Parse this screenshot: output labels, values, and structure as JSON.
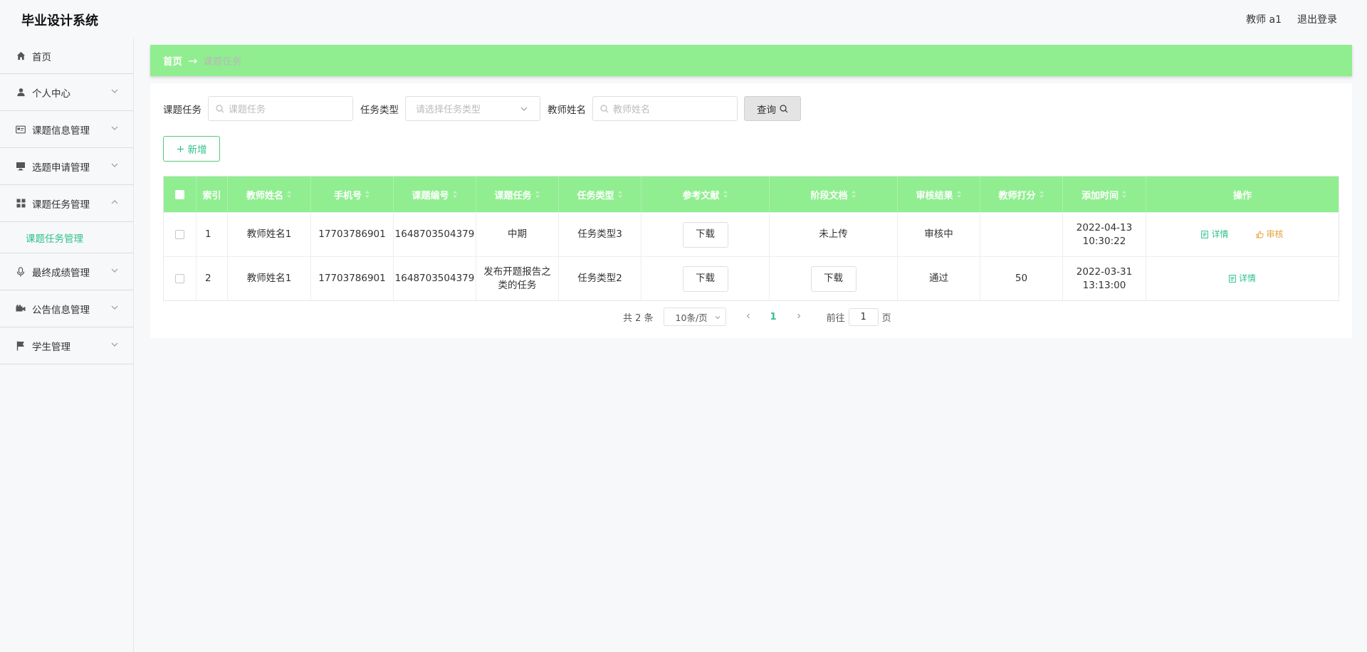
{
  "header": {
    "title": "毕业设计系统",
    "user": "教师 a1",
    "logout": "退出登录"
  },
  "sidebar": {
    "items": [
      {
        "label": "首页",
        "icon": "home-icon"
      },
      {
        "label": "个人中心",
        "icon": "user-icon"
      },
      {
        "label": "课题信息管理",
        "icon": "card-icon"
      },
      {
        "label": "选题申请管理",
        "icon": "monitor-icon"
      },
      {
        "label": "课题任务管理",
        "icon": "grid-icon"
      },
      {
        "label": "最终成绩管理",
        "icon": "microphone-icon"
      },
      {
        "label": "公告信息管理",
        "icon": "video-icon"
      },
      {
        "label": "学生管理",
        "icon": "flag-icon"
      }
    ],
    "active_sub": "课题任务管理"
  },
  "breadcrumb": {
    "home": "首页",
    "current": "课题任务"
  },
  "search": {
    "topic_label": "课题任务",
    "topic_placeholder": "课题任务",
    "type_label": "任务类型",
    "type_placeholder": "请选择任务类型",
    "teacher_label": "教师姓名",
    "teacher_placeholder": "教师姓名",
    "query_label": "查询"
  },
  "toolbar": {
    "add_label": "新增"
  },
  "table": {
    "columns": [
      "索引",
      "教师姓名",
      "手机号",
      "课题编号",
      "课题任务",
      "任务类型",
      "参考文献",
      "阶段文档",
      "审核结果",
      "教师打分",
      "添加时间",
      "操作"
    ],
    "rows": [
      {
        "index": "1",
        "teacher": "教师姓名1",
        "phone": "17703786901",
        "topic_no": "1648703504379",
        "task": "中期",
        "type": "任务类型3",
        "reference": "下载",
        "stage_doc": "未上传",
        "result": "审核中",
        "score": "",
        "time": "2022-04-13 10:30:22",
        "ops": [
          "详情",
          "审核"
        ]
      },
      {
        "index": "2",
        "teacher": "教师姓名1",
        "phone": "17703786901",
        "topic_no": "1648703504379",
        "task": "发布开题报告之类的任务",
        "type": "任务类型2",
        "reference": "下载",
        "stage_doc": "下载",
        "result": "通过",
        "score": "50",
        "time": "2022-03-31 13:13:00",
        "ops": [
          "详情"
        ]
      }
    ]
  },
  "pagination": {
    "total": "共 2 条",
    "page_size": "10条/页",
    "current_page": "1",
    "goto_prefix": "前往",
    "goto_value": "1",
    "goto_suffix": "页"
  },
  "colors": {
    "accent": "#90ee90",
    "link": "#2ec28a",
    "warning": "#e6a23c"
  }
}
